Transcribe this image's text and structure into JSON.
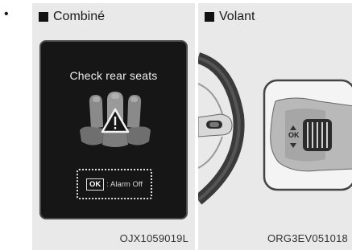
{
  "bullet": "•",
  "left_panel": {
    "header": "Combiné",
    "screen_title": "Check rear seats",
    "ok_key": "OK",
    "ok_text": ": Alarm Off",
    "image_code": "OJX1059019L"
  },
  "right_panel": {
    "header": "Volant",
    "button_label": "OK",
    "image_code": "ORG3EV051018"
  }
}
